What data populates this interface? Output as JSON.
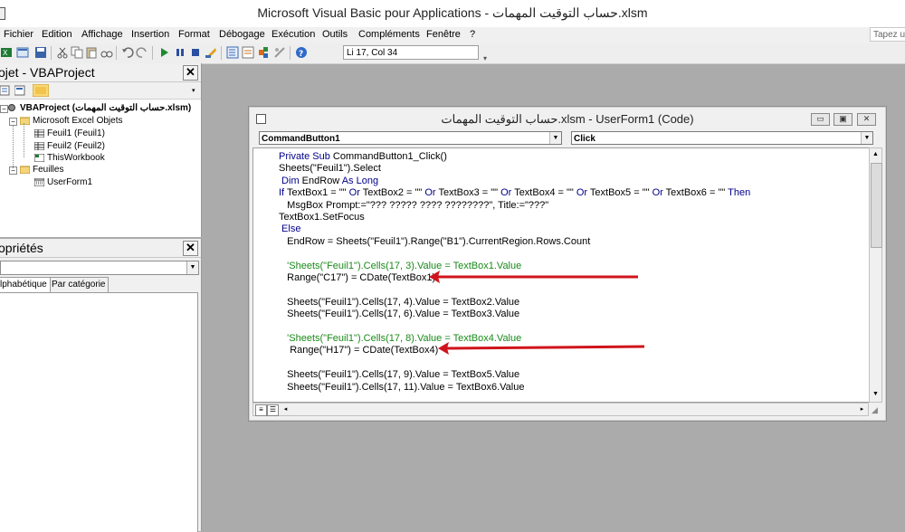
{
  "window": {
    "title": "Microsoft Visual Basic pour Applications - حساب التوقيت المهمات.xlsm"
  },
  "menu": {
    "items": [
      "Fichier",
      "Edition",
      "Affichage",
      "Insertion",
      "Format",
      "Débogage",
      "Exécution",
      "Outils",
      "Compléments",
      "Fenêtre",
      "?"
    ],
    "help_placeholder": "Tapez ur"
  },
  "toolbar": {
    "position": "Li 17, Col 34"
  },
  "project_panel": {
    "title": "ojet - VBAProject",
    "close": "✕",
    "tree": {
      "root": "VBAProject (حساب التوقيت المهمات.xlsm)",
      "folder_excel": "Microsoft Excel Objets",
      "sheet1": "Feuil1 (Feuil1)",
      "sheet2": "Feuil2 (Feuil2)",
      "workbook": "ThisWorkbook",
      "folder_forms": "Feuilles",
      "userform": "UserForm1"
    }
  },
  "props_panel": {
    "title": "opriétés",
    "close": "✕",
    "tab_alpha": "lphabétique",
    "tab_category": "Par catégorie"
  },
  "code_window": {
    "title": "حساب التوقيت المهمات.xlsm - UserForm1 (Code)",
    "object_combo": "CommandButton1",
    "proc_combo": "Click",
    "lines": [
      {
        "segments": [
          {
            "t": "Private Sub ",
            "c": "kw"
          },
          {
            "t": "CommandButton1_Click()",
            "c": ""
          }
        ]
      },
      {
        "segments": [
          {
            "t": "Sheets(\"Feuil1\").Select",
            "c": ""
          }
        ]
      },
      {
        "segments": [
          {
            "t": " Dim ",
            "c": "kw"
          },
          {
            "t": "EndRow ",
            "c": ""
          },
          {
            "t": "As Long",
            "c": "kw"
          }
        ]
      },
      {
        "segments": [
          {
            "t": "If ",
            "c": "kw"
          },
          {
            "t": "TextBox1 = \"\" ",
            "c": ""
          },
          {
            "t": "Or ",
            "c": "kw"
          },
          {
            "t": "TextBox2 = \"\" ",
            "c": ""
          },
          {
            "t": "Or ",
            "c": "kw"
          },
          {
            "t": "TextBox3 = \"\" ",
            "c": ""
          },
          {
            "t": "Or ",
            "c": "kw"
          },
          {
            "t": "TextBox4 = \"\" ",
            "c": ""
          },
          {
            "t": "Or ",
            "c": "kw"
          },
          {
            "t": "TextBox5 = \"\" ",
            "c": ""
          },
          {
            "t": "Or ",
            "c": "kw"
          },
          {
            "t": "TextBox6 = \"\" ",
            "c": ""
          },
          {
            "t": "Then",
            "c": "kw"
          }
        ]
      },
      {
        "segments": [
          {
            "t": "   MsgBox Prompt:=\"??? ????? ???? ????????\", Title:=\"???\"",
            "c": ""
          }
        ]
      },
      {
        "segments": [
          {
            "t": "TextBox1.SetFocus",
            "c": ""
          }
        ]
      },
      {
        "segments": [
          {
            "t": " Else",
            "c": "kw"
          }
        ]
      },
      {
        "segments": [
          {
            "t": "   EndRow = Sheets(\"Feuil1\").Range(\"B1\").CurrentRegion.Rows.Count",
            "c": ""
          }
        ]
      },
      {
        "segments": [
          {
            "t": "",
            "c": ""
          }
        ]
      },
      {
        "segments": [
          {
            "t": "   'Sheets(\"Feuil1\").Cells(17, 3).Value = TextBox1.Value",
            "c": "cm"
          }
        ]
      },
      {
        "segments": [
          {
            "t": "   Range(\"C17\") = CDate(TextBox1)",
            "c": ""
          }
        ]
      },
      {
        "segments": [
          {
            "t": "",
            "c": ""
          }
        ]
      },
      {
        "segments": [
          {
            "t": "   Sheets(\"Feuil1\").Cells(17, 4).Value = TextBox2.Value",
            "c": ""
          }
        ]
      },
      {
        "segments": [
          {
            "t": "   Sheets(\"Feuil1\").Cells(17, 6).Value = TextBox3.Value",
            "c": ""
          }
        ]
      },
      {
        "segments": [
          {
            "t": "",
            "c": ""
          }
        ]
      },
      {
        "segments": [
          {
            "t": "   'Sheets(\"Feuil1\").Cells(17, 8).Value = TextBox4.Value",
            "c": "cm"
          }
        ]
      },
      {
        "segments": [
          {
            "t": "    Range(\"H17\") = CDate(TextBox4)",
            "c": ""
          }
        ]
      },
      {
        "segments": [
          {
            "t": "",
            "c": ""
          }
        ]
      },
      {
        "segments": [
          {
            "t": "   Sheets(\"Feuil1\").Cells(17, 9).Value = TextBox5.Value",
            "c": ""
          }
        ]
      },
      {
        "segments": [
          {
            "t": "   Sheets(\"Feuil1\").Cells(17, 11).Value = TextBox6.Value",
            "c": ""
          }
        ]
      }
    ]
  },
  "annotation_arrow_color": "#d0141b",
  "accent_colors": {
    "keyword": "#00008b",
    "comment": "#1a8a1a"
  }
}
